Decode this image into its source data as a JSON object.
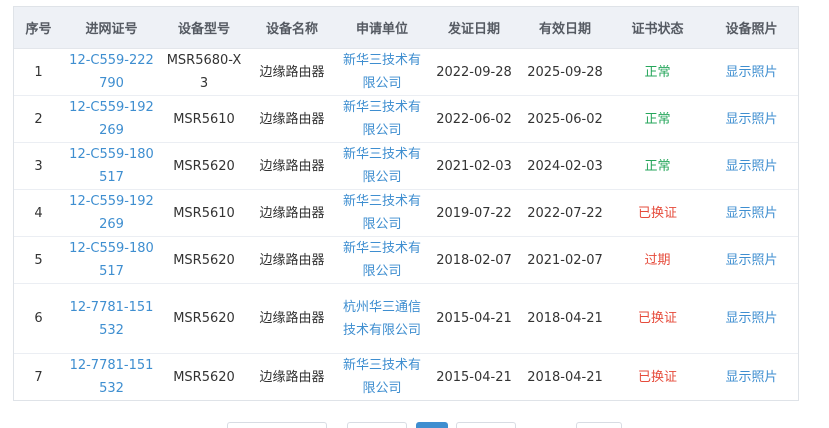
{
  "table": {
    "headers": [
      "序号",
      "进网证号",
      "设备型号",
      "设备名称",
      "申请单位",
      "发证日期",
      "有效日期",
      "证书状态",
      "设备照片"
    ],
    "rows": [
      {
        "no": "1",
        "cert": "12-C559-222790",
        "model": "MSR5680-X3",
        "name": "边缘路由器",
        "org": "新华三技术有限公司",
        "issue": "2022-09-28",
        "valid": "2025-09-28",
        "status": "正常",
        "status_type": "ok",
        "photo": "显示照片"
      },
      {
        "no": "2",
        "cert": "12-C559-192269",
        "model": "MSR5610",
        "name": "边缘路由器",
        "org": "新华三技术有限公司",
        "issue": "2022-06-02",
        "valid": "2025-06-02",
        "status": "正常",
        "status_type": "ok",
        "photo": "显示照片"
      },
      {
        "no": "3",
        "cert": "12-C559-180517",
        "model": "MSR5620",
        "name": "边缘路由器",
        "org": "新华三技术有限公司",
        "issue": "2021-02-03",
        "valid": "2024-02-03",
        "status": "正常",
        "status_type": "ok",
        "photo": "显示照片"
      },
      {
        "no": "4",
        "cert": "12-C559-192269",
        "model": "MSR5610",
        "name": "边缘路由器",
        "org": "新华三技术有限公司",
        "issue": "2019-07-22",
        "valid": "2022-07-22",
        "status": "已换证",
        "status_type": "bad",
        "photo": "显示照片"
      },
      {
        "no": "5",
        "cert": "12-C559-180517",
        "model": "MSR5620",
        "name": "边缘路由器",
        "org": "新华三技术有限公司",
        "issue": "2018-02-07",
        "valid": "2021-02-07",
        "status": "过期",
        "status_type": "bad",
        "photo": "显示照片"
      },
      {
        "no": "6",
        "cert": "12-7781-151532",
        "model": "MSR5620",
        "name": "边缘路由器",
        "org": "杭州华三通信技术有限公司",
        "issue": "2015-04-21",
        "valid": "2018-04-21",
        "status": "已换证",
        "status_type": "bad",
        "photo": "显示照片"
      },
      {
        "no": "7",
        "cert": "12-7781-151532",
        "model": "MSR5620",
        "name": "边缘路由器",
        "org": "新华三技术有限公司",
        "issue": "2015-04-21",
        "valid": "2018-04-21",
        "status": "已换证",
        "status_type": "bad",
        "photo": "显示照片"
      }
    ]
  },
  "colors": {
    "link": "#3e8ed0",
    "status_ok": "#26a65b",
    "status_bad": "#e64c3c",
    "header_bg": "#eef1f6"
  }
}
